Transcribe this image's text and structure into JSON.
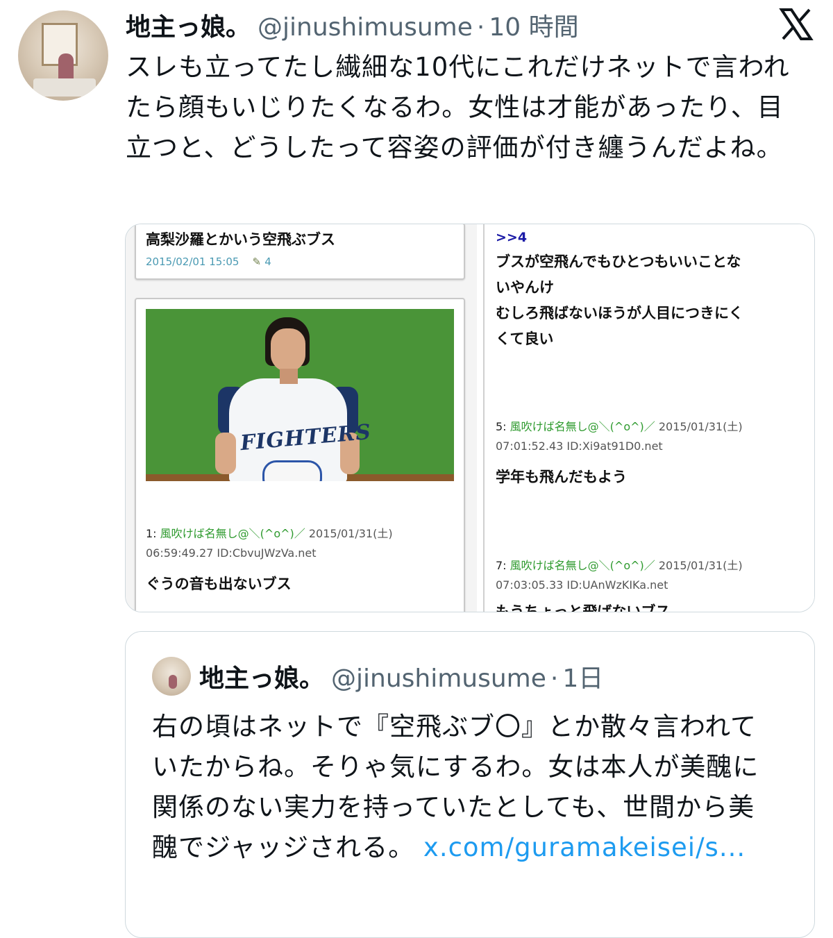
{
  "tweet": {
    "author_name": "地主っ娘。",
    "handle": "@jinushimusume",
    "separator": "·",
    "time": "10 時間",
    "text": "スレも立ってたし繊細な10代にこれだけネットで言われたら顔もいじりたくなるわ。女性は才能があったり、目立つと、どうしたって容姿の評価が付き纏うんだよね。"
  },
  "media": {
    "thread_title": "高梨沙羅とかいう空飛ぶブス",
    "thread_date": "2015/02/01 15:05",
    "thread_count": "4",
    "thread_count_icon": "comment-icon",
    "post1": {
      "number": "1:",
      "poster": "風吹けば名無し@＼(^o^)／",
      "date": "2015/01/31(土)",
      "time_id": "06:59:49.27 ID:CbvuJWzVa.net",
      "body": "ぐうの音も出ないブス"
    },
    "jersey_text": "FIGHTERS",
    "reply_anchor": ">>4",
    "reply_body_lines": [
      "ブスが空飛んでもひとつもいいことな",
      "いやんけ",
      "むしろ飛ばないほうが人目につきにく",
      "くて良い"
    ],
    "post5": {
      "number": "5:",
      "poster": "風吹けば名無し@＼(^o^)／",
      "date": "2015/01/31(土)",
      "time_id": "07:01:52.43 ID:Xi9at91D0.net",
      "body": "学年も飛んだもよう"
    },
    "post7": {
      "number": "7:",
      "poster": "風吹けば名無し@＼(^o^)／",
      "date": "2015/01/31(土)",
      "time_id": "07:03:05.33 ID:UAnWzKIKa.net",
      "body": "もうちょっと飛ばないブス"
    }
  },
  "quote": {
    "author_name": "地主っ娘。",
    "handle": "@jinushimusume",
    "separator": "·",
    "time": "1日",
    "text": "右の頃はネットで『空飛ぶブ〇』とか散々言われていたからね。そりゃ気にするわ。女は本人が美醜に関係のない実力を持っていたとしても、世間から美醜でジャッジされる。",
    "link": " x.com/guramakeisei/s..."
  },
  "colors": {
    "text": "#0f1419",
    "secondary": "#536471",
    "link": "#1d9bf0",
    "border": "#cfd9de"
  }
}
